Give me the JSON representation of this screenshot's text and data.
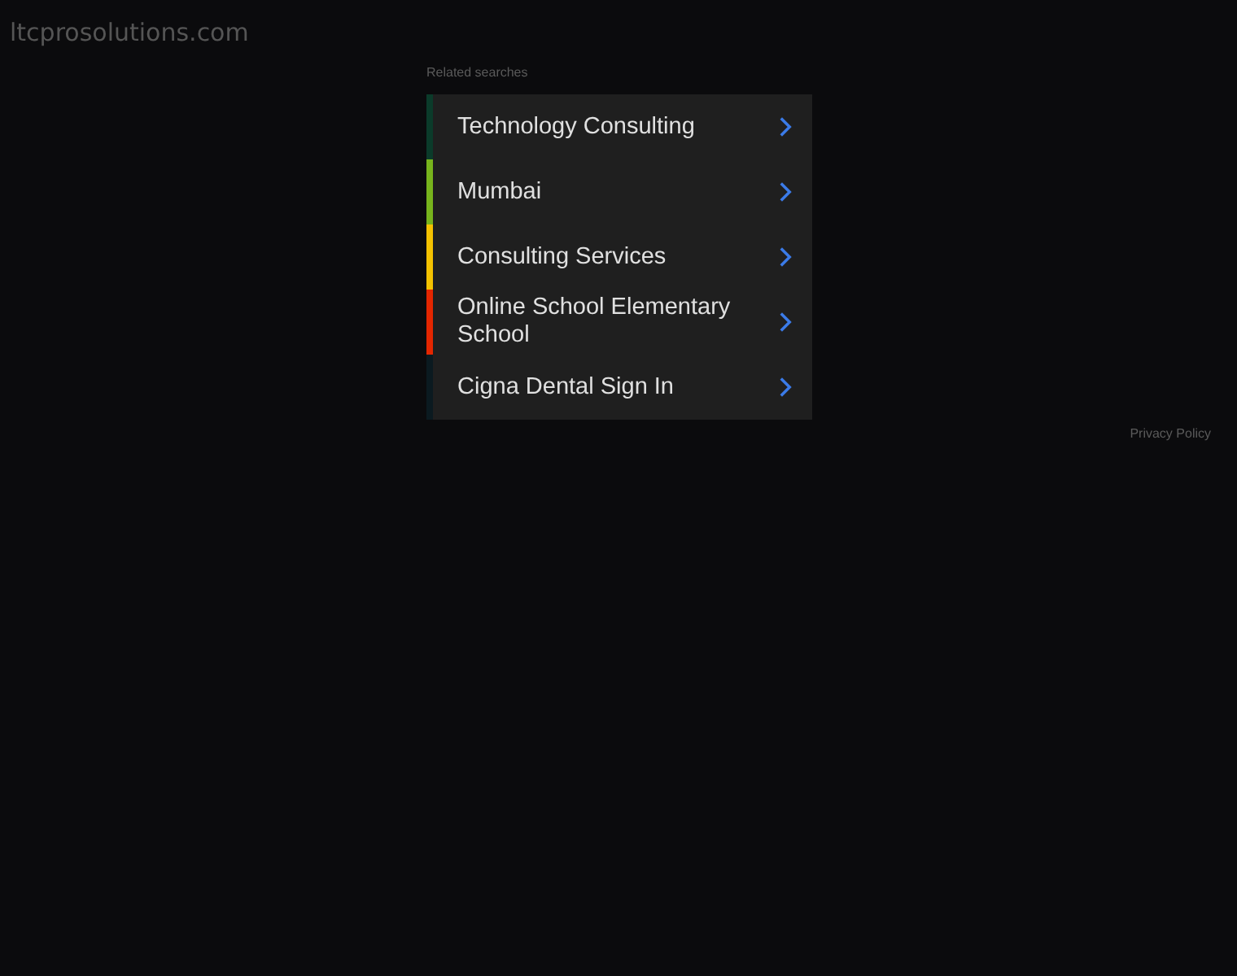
{
  "site_title": "ltcprosolutions.com",
  "related_heading": "Related searches",
  "links": [
    {
      "label": "Technology Consulting",
      "color": "#0b3b2a"
    },
    {
      "label": "Mumbai",
      "color": "#77b41c"
    },
    {
      "label": "Consulting Services",
      "color": "#f4c200"
    },
    {
      "label": "Online School Elementary School",
      "color": "#e42600"
    },
    {
      "label": "Cigna Dental Sign In",
      "color": "#0b1a20"
    }
  ],
  "footer_link": "Privacy Policy"
}
